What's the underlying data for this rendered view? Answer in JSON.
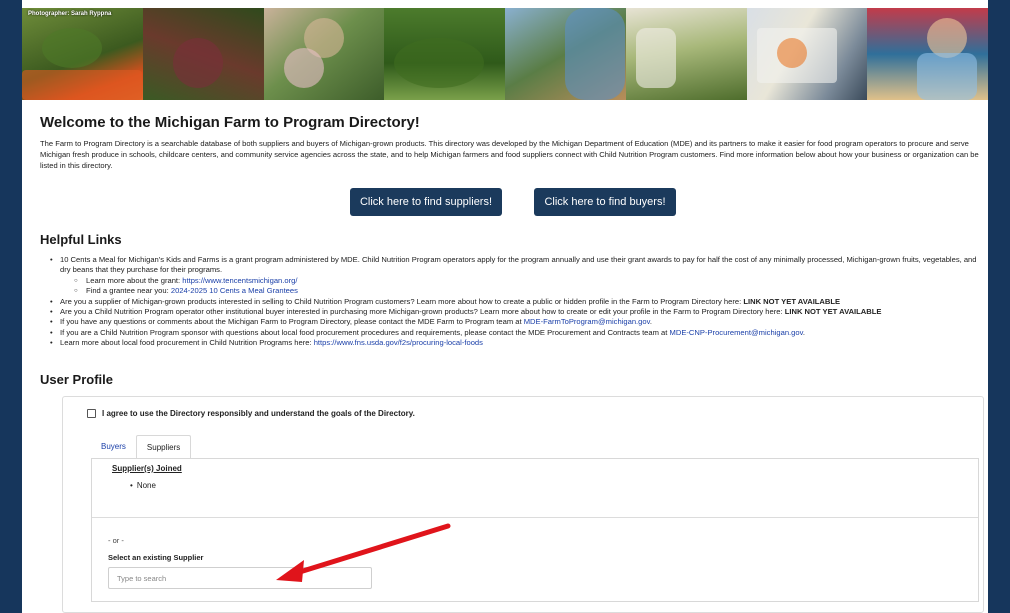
{
  "banner": {
    "photo_credit": "Photographer: Sarah Ryppna"
  },
  "welcome": {
    "title": "Welcome to the Michigan Farm to Program Directory!",
    "intro": "The Farm to Program Directory is a searchable database of both suppliers and buyers of Michigan-grown products. This directory was developed by the Michigan Department of Education (MDE) and its partners to make it easier for food program operators to procure and serve Michigan fresh produce in schools, childcare centers, and community service agencies across the state, and to help Michigan farmers and food suppliers connect with Child Nutrition Program customers. Find more information below about how your business or organization can be listed in this directory.",
    "find_suppliers_label": "Click here to find suppliers!",
    "find_buyers_label": "Click here to find buyers!"
  },
  "helpful_links": {
    "title": "Helpful Links",
    "item1_text": "10 Cents a Meal for Michigan's Kids and Farms is a grant program administered by MDE. Child Nutrition Program operators apply for the program annually and use their grant awards to pay for half the cost of any minimally processed, Michigan-grown fruits, vegetables, and dry beans that they purchase for their programs.",
    "sub1_prefix": "Learn more about the grant: ",
    "sub1_link": "https://www.tencentsmichigan.org/",
    "sub2_prefix": "Find a grantee near you: ",
    "sub2_link": "2024-2025 10 Cents a Meal Grantees",
    "item2_text": "Are you a supplier of Michigan-grown products interested in selling to Child Nutrition Program customers? Learn more about how to create a public or hidden profile in the Farm to Program Directory here: ",
    "item2_bold": "LINK NOT YET AVAILABLE",
    "item3_text": "Are you a Child Nutrition Program operator other institutional buyer interested in purchasing more Michigan-grown products? Learn more about how to create or edit your profile in the Farm to Program Directory here: ",
    "item3_bold": "LINK NOT YET AVAILABLE",
    "item4_text": "If you have any questions or comments about the Michigan Farm to Program Directory, please contact the MDE Farm to Program team at ",
    "item4_link": "MDE-FarmToProgram@michigan.gov",
    "item4_suffix": ".",
    "item5_text": "If you are a Child Nutrition Program sponsor with questions about local food procurement procedures and requirements, please contact the MDE Procurement and Contracts team at ",
    "item5_link": "MDE-CNP-Procurement@michigan.gov",
    "item5_suffix": ".",
    "item6_text": "Learn more about local food procurement in Child Nutrition Programs here: ",
    "item6_link": "https://www.fns.usda.gov/f2s/procuring-local-foods"
  },
  "user_profile": {
    "title": "User Profile",
    "agree_label": "I agree to use the Directory responsibly and understand the goals of the Directory.",
    "tabs": [
      {
        "label": "Buyers"
      },
      {
        "label": "Suppliers"
      }
    ],
    "joined_title": "Supplier(s) Joined",
    "joined_items": [
      "None"
    ],
    "or_text": "- or -",
    "select_label": "Select an existing Supplier",
    "search_placeholder": "Type to search"
  },
  "colors": {
    "navy": "#1b3a5c",
    "link": "#1a3fa8",
    "annotation_arrow": "#e0141b"
  }
}
